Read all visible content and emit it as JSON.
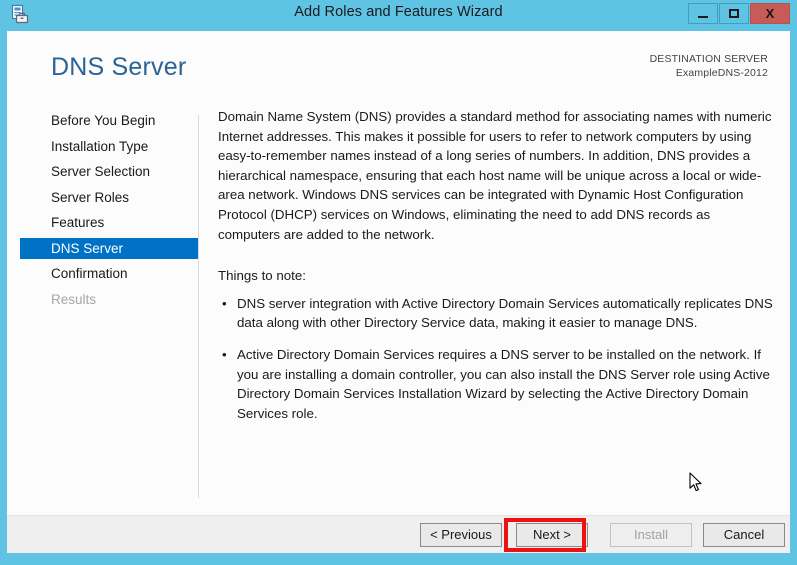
{
  "window": {
    "title": "Add Roles and Features Wizard",
    "app_icon": "server-roles-icon",
    "controls": {
      "minimize": "minimize-icon",
      "maximize": "maximize-icon",
      "close": "X"
    },
    "accent_color": "#5fc3e4",
    "close_button_color": "#c75b57"
  },
  "header": {
    "page_title": "DNS Server",
    "destination_label": "DESTINATION SERVER",
    "destination_value": "ExampleDNS-2012",
    "title_color": "#2a6496"
  },
  "sidebar": {
    "selected_color": "#0072c6",
    "items": [
      {
        "label": "Before You Begin",
        "state": "normal"
      },
      {
        "label": "Installation Type",
        "state": "normal"
      },
      {
        "label": "Server Selection",
        "state": "normal"
      },
      {
        "label": "Server Roles",
        "state": "normal"
      },
      {
        "label": "Features",
        "state": "normal"
      },
      {
        "label": "DNS Server",
        "state": "selected"
      },
      {
        "label": "Confirmation",
        "state": "normal"
      },
      {
        "label": "Results",
        "state": "disabled"
      }
    ]
  },
  "content": {
    "intro": "Domain Name System (DNS) provides a standard method for associating names with numeric Internet addresses. This makes it possible for users to refer to network computers by using easy-to-remember names instead of a long series of numbers. In addition, DNS provides a hierarchical namespace, ensuring that each host name will be unique across a local or wide-area network. Windows DNS services can be integrated with Dynamic Host Configuration Protocol (DHCP) services on Windows, eliminating the need to add DNS records as computers are added to the network.",
    "notes_heading": "Things to note:",
    "notes": [
      "DNS server integration with Active Directory Domain Services automatically replicates DNS data along with other Directory Service data, making it easier to manage DNS.",
      "Active Directory Domain Services requires a DNS server to be installed on the network. If you are installing a domain controller, you can also install the DNS Server role using Active Directory Domain Services Installation Wizard by selecting the Active Directory Domain Services role."
    ],
    "bullet_glyph": "•"
  },
  "footer": {
    "previous_label": "< Previous",
    "next_label": "Next >",
    "install_label": "Install",
    "cancel_label": "Cancel",
    "install_enabled": false,
    "highlight_color": "#ee1111",
    "highlighted_button": "Next >"
  }
}
